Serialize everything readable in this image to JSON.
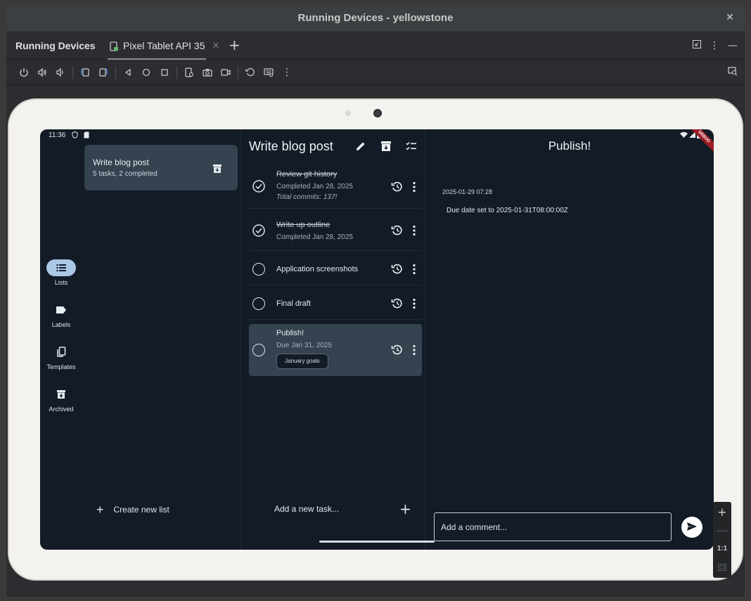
{
  "window": {
    "title": "Running Devices - yellowstone"
  },
  "tabbar": {
    "panel_title": "Running Devices",
    "device_tab": "Pixel Tablet API 35"
  },
  "device": {
    "status_time": "11:36",
    "debug_label": "DEBUG",
    "rail": [
      {
        "label": "Lists",
        "icon": "list-icon",
        "active": true
      },
      {
        "label": "Labels",
        "icon": "label-icon",
        "active": false
      },
      {
        "label": "Templates",
        "icon": "templates-icon",
        "active": false
      },
      {
        "label": "Archived",
        "icon": "archive-icon",
        "active": false
      }
    ],
    "lists": {
      "card_title": "Write blog post",
      "card_subtitle": "5 tasks, 2 completed",
      "create_label": "Create new list"
    },
    "tasks": {
      "header": "Write blog post",
      "items": [
        {
          "title": "Review git history",
          "subtitle": "Completed Jan 28, 2025",
          "note": "Total commits: 137!",
          "done": true
        },
        {
          "title": "Write up outline",
          "subtitle": "Completed Jan 28, 2025",
          "done": true
        },
        {
          "title": "Application screenshots",
          "done": false
        },
        {
          "title": "Final draft",
          "done": false
        },
        {
          "title": "Publish!",
          "subtitle": "Due Jan 31, 2025",
          "chip": "January goals",
          "done": false,
          "selected": true
        }
      ],
      "add_placeholder": "Add a new task..."
    },
    "detail": {
      "title": "Publish!",
      "timestamp": "2025-01-29 07:28",
      "comment": "Due date set to 2025-01-31T08:00:00Z",
      "comment_placeholder": "Add a comment..."
    }
  },
  "zoom": {
    "one_to_one": "1:1"
  }
}
